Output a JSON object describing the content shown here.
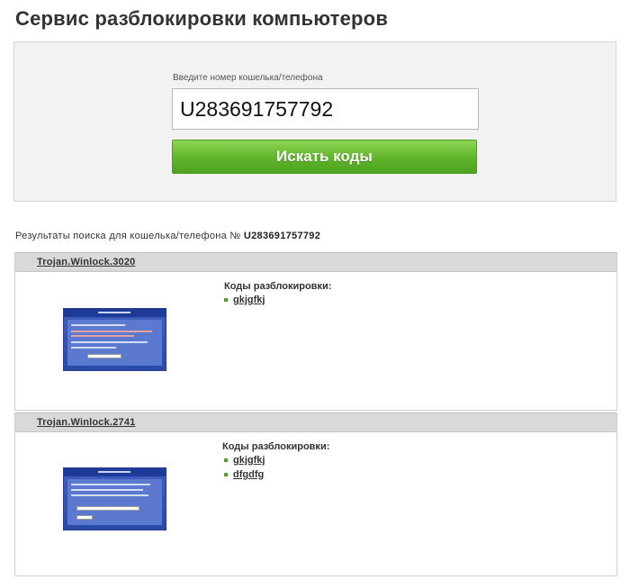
{
  "page": {
    "title": "Сервис разблокировки компьютеров"
  },
  "search": {
    "label": "Введите номер кошелька/телефона",
    "value": "U283691757792",
    "button_label": "Искать коды"
  },
  "results": {
    "caption_prefix": "Результаты поиска для кошелька/телефона №",
    "caption_number": "U283691757792",
    "items": [
      {
        "name": "Trojan.Winlock.3020",
        "codes_label": "Коды разблокировки:",
        "codes": [
          "gkjgfkj"
        ]
      },
      {
        "name": "Trojan.Winlock.2741",
        "codes_label": "Коды разблокировки:",
        "codes": [
          "gkjgfkj",
          "dfgdfg"
        ]
      }
    ]
  },
  "colors": {
    "button_green": "#5eb42a",
    "bullet_green": "#4da42a",
    "panel_bg": "#f2f2f2",
    "header_bg": "#d9d9d9",
    "thumb_blue": "#3e5fc0"
  }
}
